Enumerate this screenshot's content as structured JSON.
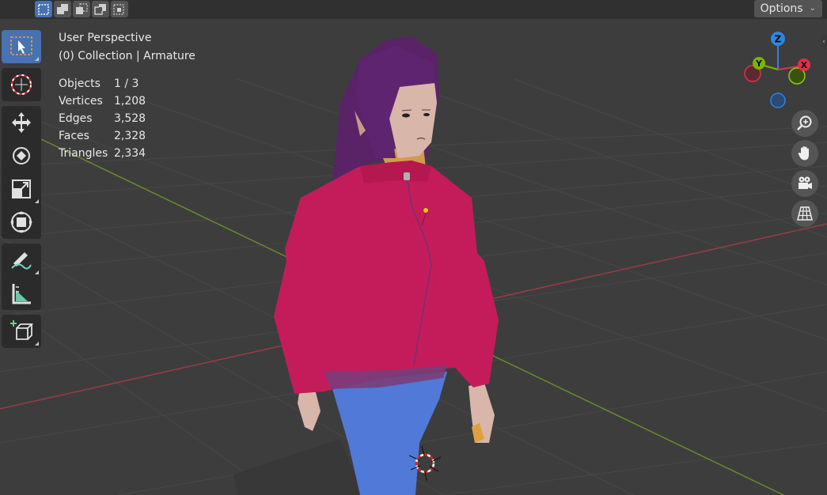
{
  "header": {
    "options_label": "Options",
    "select_modes": [
      {
        "name": "select-new-mode",
        "active": true
      },
      {
        "name": "select-extend-mode",
        "active": false
      },
      {
        "name": "select-subtract-mode",
        "active": false
      },
      {
        "name": "select-invert-mode",
        "active": false
      },
      {
        "name": "select-intersect-mode",
        "active": false
      }
    ]
  },
  "viewport": {
    "view_name": "User Perspective",
    "collection_line": "(0) Collection | Armature"
  },
  "stats": [
    {
      "label": "Objects",
      "value": "1 / 3"
    },
    {
      "label": "Vertices",
      "value": "1,208"
    },
    {
      "label": "Edges",
      "value": "3,528"
    },
    {
      "label": "Faces",
      "value": "2,328"
    },
    {
      "label": "Triangles",
      "value": "2,334"
    }
  ],
  "toolbar": {
    "tools": [
      "select-box-tool",
      "cursor-tool",
      "move-tool",
      "rotate-tool",
      "scale-tool",
      "transform-tool",
      "annotate-tool",
      "measure-tool",
      "add-cube-tool"
    ]
  },
  "gizmo": {
    "z_label": "Z",
    "y_label": "Y",
    "x_label": "X"
  },
  "nav_buttons": [
    "zoom-icon",
    "hand-pan-icon",
    "camera-icon",
    "grid-ortho-icon"
  ],
  "colors": {
    "background": "#3d3d3d",
    "header": "#303030",
    "active": "#4772b3",
    "axis_x": "#ff3352",
    "axis_y": "#8bdc00",
    "axis_z": "#2890ff",
    "jacket": "#c21a5a",
    "pants": "#4f77d6",
    "hair": "#5a2368"
  }
}
